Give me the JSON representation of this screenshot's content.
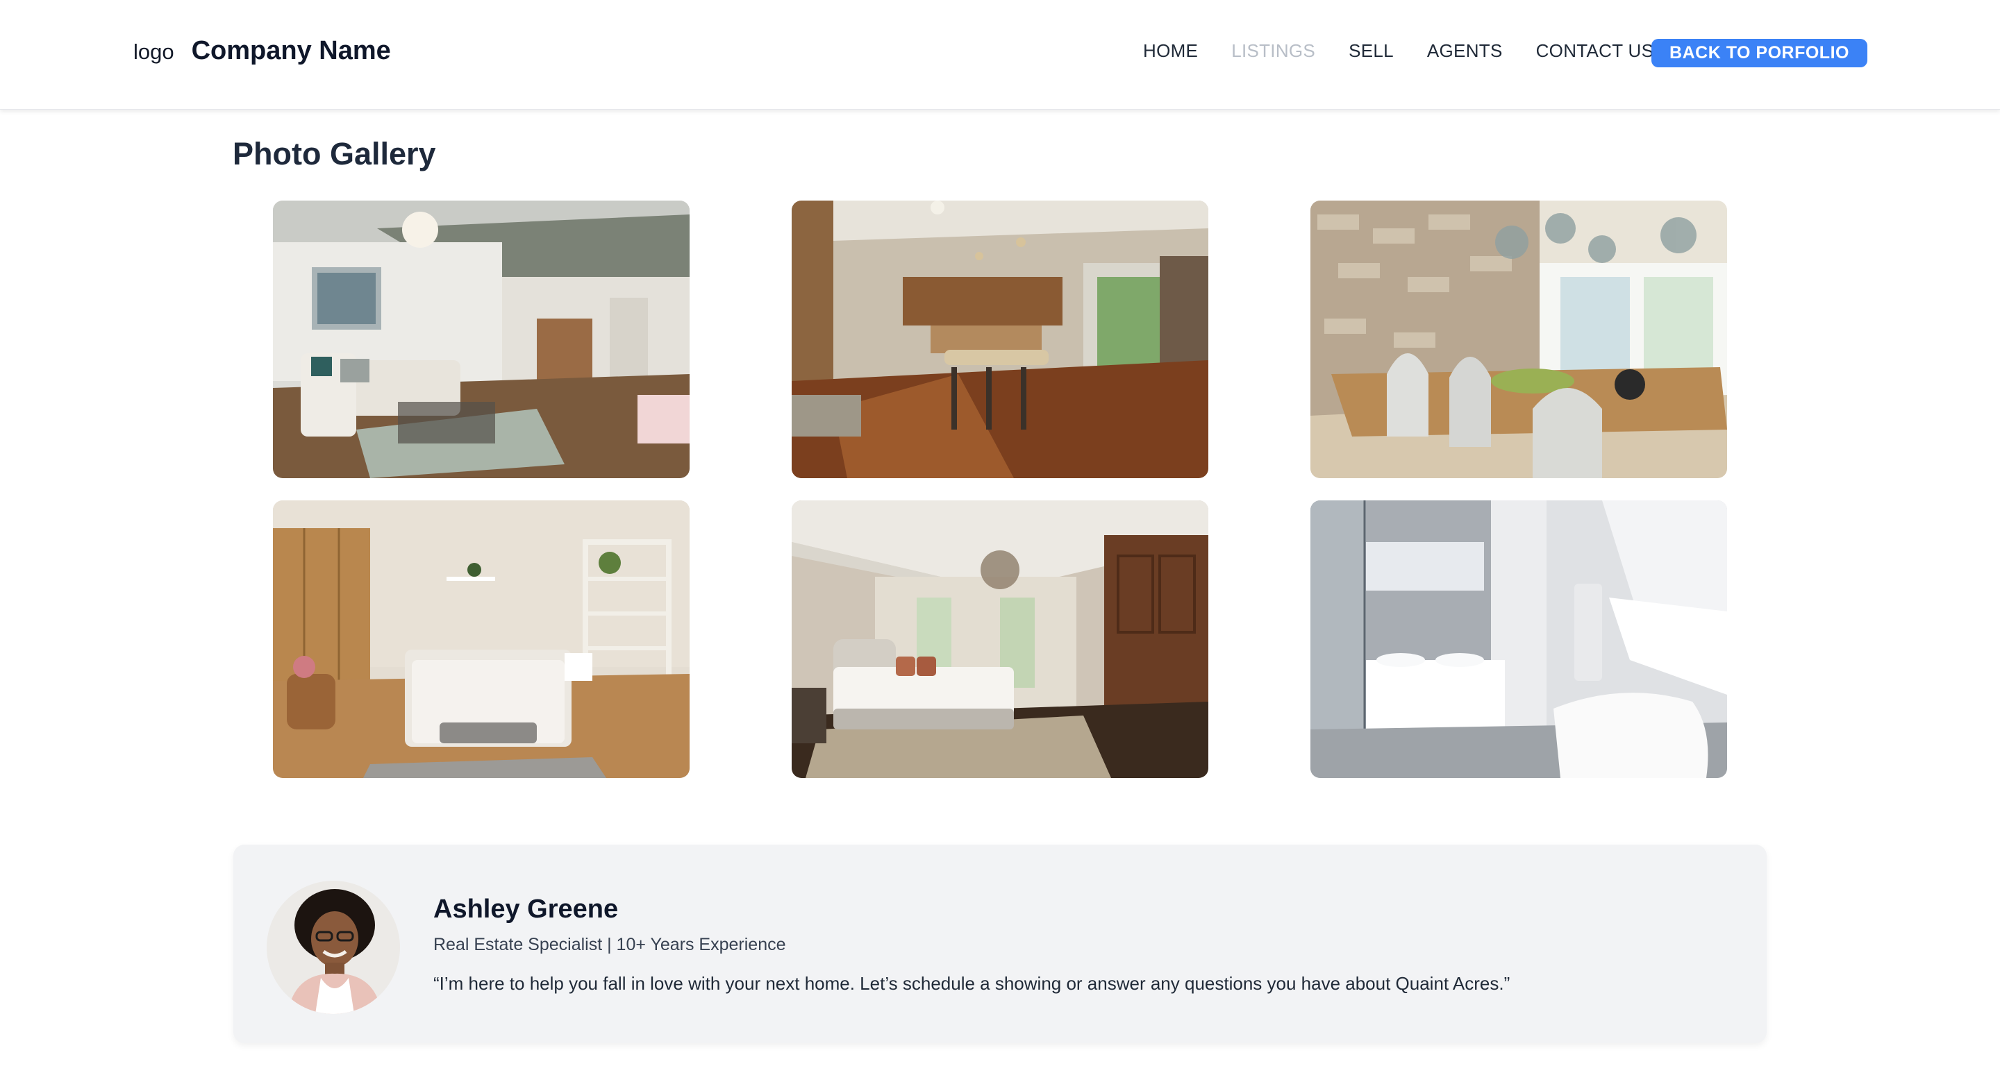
{
  "header": {
    "logo": "logo",
    "company_name": "Company Name",
    "nav": [
      {
        "label": "HOME",
        "active": false
      },
      {
        "label": "LISTINGS",
        "active": true
      },
      {
        "label": "SELL",
        "active": false
      },
      {
        "label": "AGENTS",
        "active": false
      },
      {
        "label": "CONTACT US",
        "active": false
      }
    ],
    "back_button": "BACK TO PORFOLIO"
  },
  "gallery": {
    "title": "Photo Gallery",
    "photos": [
      {
        "icon": "living-room-photo"
      },
      {
        "icon": "kitchen-photo"
      },
      {
        "icon": "dining-room-photo"
      },
      {
        "icon": "bedroom-photo"
      },
      {
        "icon": "master-bedroom-photo"
      },
      {
        "icon": "bathroom-photo"
      }
    ]
  },
  "agent": {
    "name": "Ashley Greene",
    "title": "Real Estate Specialist | 10+ Years Experience",
    "quote": "“I’m here to help you fall in love with your next home. Let’s schedule a showing or answer any questions you have about Quaint Acres.”"
  },
  "colors": {
    "accent": "#3b82f6",
    "nav_active": "#b8bec7",
    "card_bg": "#f2f3f5"
  }
}
